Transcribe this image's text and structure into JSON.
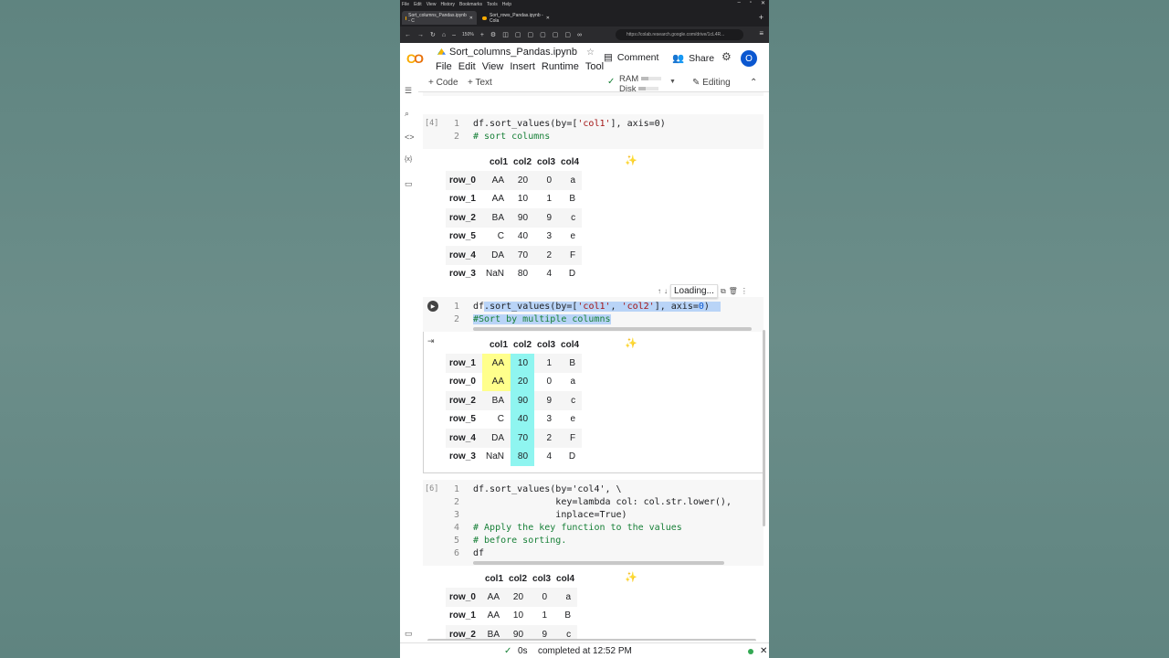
{
  "browser": {
    "menu": [
      "File",
      "Edit",
      "View",
      "History",
      "Bookmarks",
      "Tools",
      "Help"
    ],
    "tabs": [
      {
        "label": "Sort_columns_Pandas.ipynb - C",
        "active": true
      },
      {
        "label": "Sort_rows_Pandas.ipynb - Cola",
        "active": false
      }
    ],
    "zoom": "150%",
    "url": "https://colab.research.google.com/drive/1cL4R..."
  },
  "colab": {
    "logo": "CO",
    "title": "Sort_columns_Pandas.ipynb",
    "menus": [
      "File",
      "Edit",
      "View",
      "Insert",
      "Runtime",
      "Tool"
    ],
    "comment": "Comment",
    "share": "Share",
    "avatar": "O",
    "add_code": "+ Code",
    "add_text": "+ Text",
    "ram": "RAM",
    "disk": "Disk",
    "editing": "Editing"
  },
  "cells": [
    {
      "exec": "[4]",
      "code_line1": [
        "df.sort_values(by=[",
        "'col1'",
        "], axis=0)"
      ],
      "code_line2": "# sort columns",
      "table": {
        "columns": [
          "col1",
          "col2",
          "col3",
          "col4"
        ],
        "rows": [
          [
            "row_0",
            "AA",
            "20",
            "0",
            "a"
          ],
          [
            "row_1",
            "AA",
            "10",
            "1",
            "B"
          ],
          [
            "row_2",
            "BA",
            "90",
            "9",
            "c"
          ],
          [
            "row_5",
            "C",
            "40",
            "3",
            "e"
          ],
          [
            "row_4",
            "DA",
            "70",
            "2",
            "F"
          ],
          [
            "row_3",
            "NaN",
            "80",
            "4",
            "D"
          ]
        ]
      }
    },
    {
      "loading": "Loading...",
      "code_line1": [
        "df",
        ".sort_values(by=[",
        "'col1'",
        ", ",
        "'col2'",
        "], axis=",
        "0",
        ")"
      ],
      "code_line2": "#Sort by multiple columns",
      "table": {
        "columns": [
          "col1",
          "col2",
          "col3",
          "col4"
        ],
        "rows": [
          [
            "row_1",
            "AA",
            "10",
            "1",
            "B"
          ],
          [
            "row_0",
            "AA",
            "20",
            "0",
            "a"
          ],
          [
            "row_2",
            "BA",
            "90",
            "9",
            "c"
          ],
          [
            "row_5",
            "C",
            "40",
            "3",
            "e"
          ],
          [
            "row_4",
            "DA",
            "70",
            "2",
            "F"
          ],
          [
            "row_3",
            "NaN",
            "80",
            "4",
            "D"
          ]
        ]
      }
    },
    {
      "exec": "[6]",
      "code": [
        "df.sort_values(by='col4', \\",
        "               key=lambda col: col.str.lower(),",
        "               inplace=True)",
        "# Apply the key function to the values",
        "# before sorting.",
        "df"
      ],
      "table": {
        "columns": [
          "col1",
          "col2",
          "col3",
          "col4"
        ],
        "rows": [
          [
            "row_0",
            "AA",
            "20",
            "0",
            "a"
          ],
          [
            "row_1",
            "AA",
            "10",
            "1",
            "B"
          ],
          [
            "row_2",
            "BA",
            "90",
            "9",
            "c"
          ]
        ]
      }
    }
  ],
  "status": {
    "time": "0s",
    "message": "completed at 12:52 PM"
  }
}
